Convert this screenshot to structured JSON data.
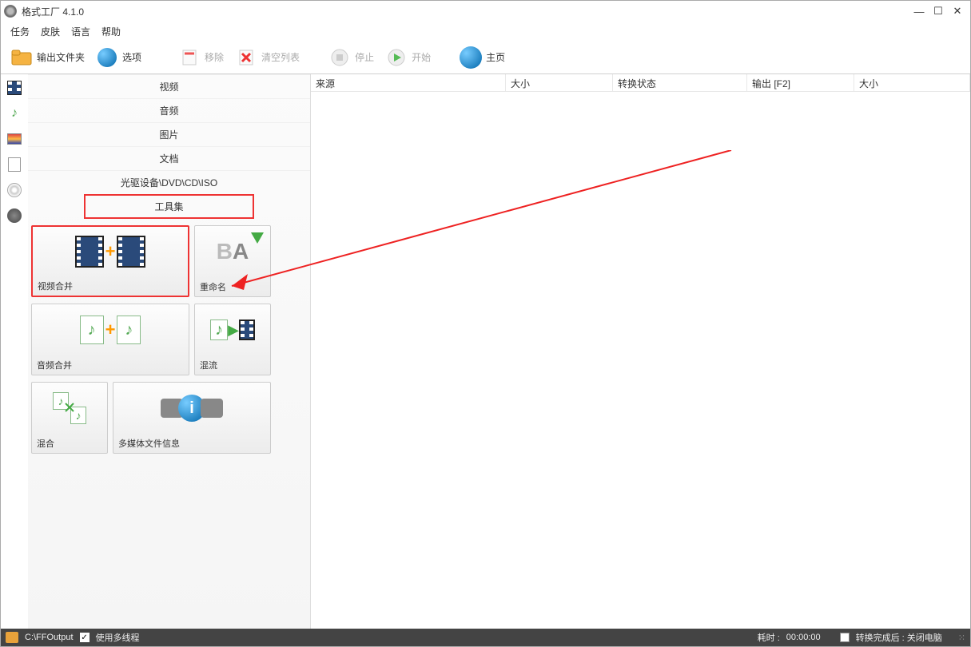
{
  "title": "格式工厂 4.1.0",
  "menu": {
    "task": "任务",
    "skin": "皮肤",
    "lang": "语言",
    "help": "帮助"
  },
  "toolbar": {
    "output": "输出文件夹",
    "options": "选项",
    "remove": "移除",
    "clear": "清空列表",
    "stop": "停止",
    "start": "开始",
    "home": "主页"
  },
  "side": {
    "video": "视频",
    "audio": "音频",
    "image": "图片",
    "doc": "文档",
    "optical": "光驱设备\\DVD\\CD\\ISO",
    "tools": "工具集"
  },
  "tiles": {
    "video_merge": "视频合并",
    "rename": "重命名",
    "audio_merge": "音频合并",
    "mux": "混流",
    "mix": "混合",
    "media_info": "多媒体文件信息"
  },
  "columns": {
    "source": "来源",
    "size": "大小",
    "state": "转换状态",
    "output": "输出 [F2]",
    "size2": "大小"
  },
  "status": {
    "path": "C:\\FFOutput",
    "multithread": "使用多线程",
    "elapsed_label": "耗时 :",
    "elapsed": "00:00:00",
    "after": "转换完成后 : 关闭电脑"
  }
}
